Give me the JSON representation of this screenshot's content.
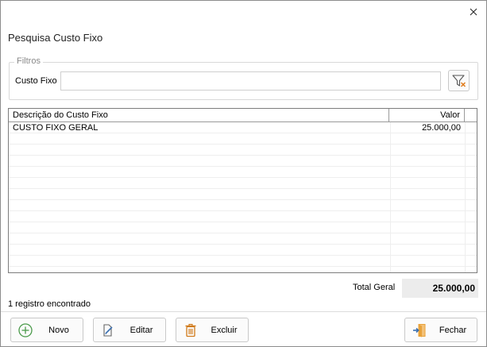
{
  "window": {
    "title": "Pesquisa Custo Fixo",
    "close_icon": "close-icon"
  },
  "filters": {
    "legend": "Filtros",
    "custo_fixo_label": "Custo Fixo",
    "custo_fixo_value": "",
    "clear_filter_icon": "filter-clear-icon"
  },
  "grid": {
    "columns": [
      "Descrição do Custo Fixo",
      "Valor"
    ],
    "rows": [
      {
        "descricao": "CUSTO FIXO GERAL",
        "valor": "25.000,00"
      }
    ]
  },
  "totals": {
    "label": "Total Geral",
    "value": "25.000,00"
  },
  "status": {
    "records": "1 registro encontrado"
  },
  "buttons": {
    "novo": "Novo",
    "editar": "Editar",
    "excluir": "Excluir",
    "fechar": "Fechar"
  },
  "colors": {
    "novo_icon": "#4a9a4a",
    "excluir_icon": "#d07a1a",
    "fechar_icon": "#e8a23a",
    "filter_x": "#e07b1a"
  }
}
